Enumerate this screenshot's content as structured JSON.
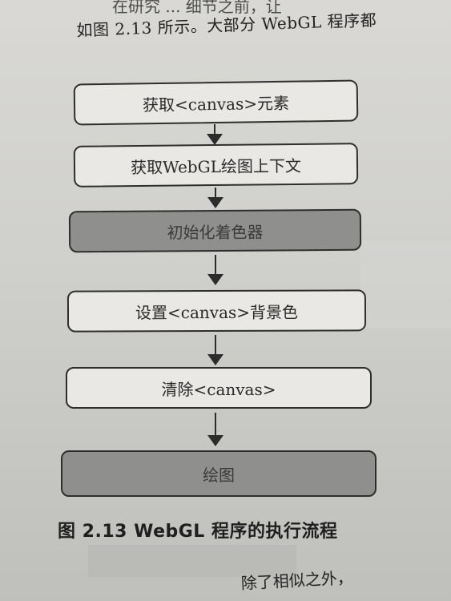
{
  "page": {
    "top_text_line": "如图 2.13 所示。大部分 WebGL 程序都",
    "top_text_clipped": "在研究 ... 细节之前，让",
    "bottom_text": "除了相似之外，"
  },
  "diagram": {
    "nodes": [
      {
        "id": "n1",
        "label": "获取<canvas>元素",
        "style": "light"
      },
      {
        "id": "n2",
        "label": "获取WebGL绘图上下文",
        "style": "light"
      },
      {
        "id": "n3",
        "label": "初始化着色器",
        "style": "dark"
      },
      {
        "id": "n4",
        "label": "设置<canvas>背景色",
        "style": "light"
      },
      {
        "id": "n5",
        "label": "清除<canvas>",
        "style": "light"
      },
      {
        "id": "n6",
        "label": "绘图",
        "style": "dark"
      }
    ],
    "edges": [
      {
        "from": "n1",
        "to": "n2"
      },
      {
        "from": "n2",
        "to": "n3"
      },
      {
        "from": "n3",
        "to": "n4"
      },
      {
        "from": "n4",
        "to": "n5"
      },
      {
        "from": "n5",
        "to": "n6"
      }
    ],
    "caption": "图 2.13  WebGL 程序的执行流程"
  }
}
